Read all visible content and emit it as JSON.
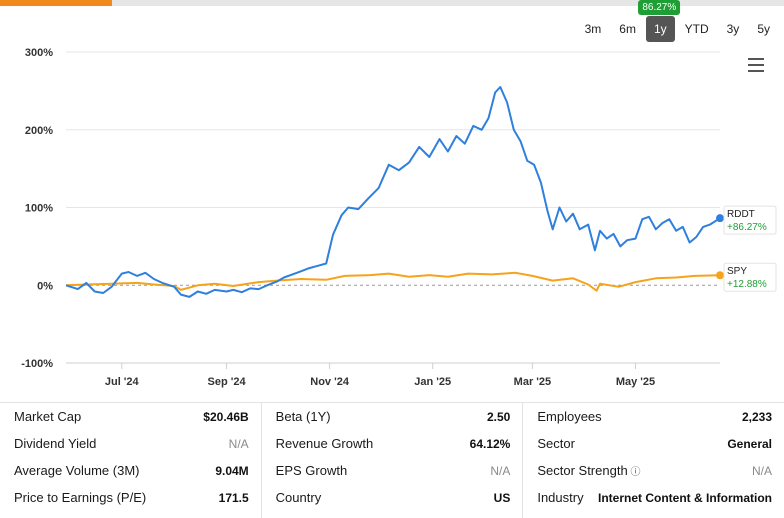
{
  "progress": {
    "fraction": 0.143,
    "color": "#f08a1c"
  },
  "range_tabs": [
    {
      "label": "3m",
      "active": false
    },
    {
      "label": "6m",
      "active": false
    },
    {
      "label": "1y",
      "active": true
    },
    {
      "label": "YTD",
      "active": false
    },
    {
      "label": "3y",
      "active": false
    },
    {
      "label": "5y",
      "active": false
    }
  ],
  "perf_badge": "86.27%",
  "menu": {
    "icon": "hamburger-menu-icon"
  },
  "chart_data": {
    "type": "line",
    "title": "",
    "xlabel": "",
    "ylabel": "",
    "ylim": [
      -100,
      300
    ],
    "y_ticks": [
      "300%",
      "200%",
      "100%",
      "0%",
      "-100%"
    ],
    "y_tick_values": [
      300,
      200,
      100,
      0,
      -100
    ],
    "x_range": [
      "2024-05-29",
      "2025-06-20"
    ],
    "x_ticks": [
      {
        "date": "2024-07-01",
        "label": "Jul '24"
      },
      {
        "date": "2024-09-01",
        "label": "Sep '24"
      },
      {
        "date": "2024-11-01",
        "label": "Nov '24"
      },
      {
        "date": "2025-01-01",
        "label": "Jan '25"
      },
      {
        "date": "2025-03-01",
        "label": "Mar '25"
      },
      {
        "date": "2025-05-01",
        "label": "May '25"
      }
    ],
    "grid": "horizontal",
    "legend": "right-end labels",
    "series": [
      {
        "name": "RDDT",
        "change": "+86.27%",
        "color": "#2f7fde",
        "change_color": "#1e9e34",
        "points": [
          [
            "2024-05-29",
            0
          ],
          [
            "2024-06-05",
            -5
          ],
          [
            "2024-06-10",
            3
          ],
          [
            "2024-06-15",
            -8
          ],
          [
            "2024-06-20",
            -10
          ],
          [
            "2024-06-25",
            -2
          ],
          [
            "2024-07-01",
            15
          ],
          [
            "2024-07-05",
            17
          ],
          [
            "2024-07-10",
            12
          ],
          [
            "2024-07-15",
            16
          ],
          [
            "2024-07-20",
            8
          ],
          [
            "2024-07-25",
            3
          ],
          [
            "2024-08-01",
            -2
          ],
          [
            "2024-08-05",
            -12
          ],
          [
            "2024-08-10",
            -15
          ],
          [
            "2024-08-15",
            -8
          ],
          [
            "2024-08-20",
            -11
          ],
          [
            "2024-08-25",
            -6
          ],
          [
            "2024-09-01",
            -8
          ],
          [
            "2024-09-05",
            -6
          ],
          [
            "2024-09-10",
            -9
          ],
          [
            "2024-09-15",
            -4
          ],
          [
            "2024-09-20",
            -5
          ],
          [
            "2024-09-25",
            0
          ],
          [
            "2024-10-01",
            5
          ],
          [
            "2024-10-05",
            10
          ],
          [
            "2024-10-10",
            14
          ],
          [
            "2024-10-15",
            18
          ],
          [
            "2024-10-20",
            22
          ],
          [
            "2024-10-25",
            25
          ],
          [
            "2024-10-30",
            28
          ],
          [
            "2024-11-03",
            65
          ],
          [
            "2024-11-08",
            90
          ],
          [
            "2024-11-12",
            100
          ],
          [
            "2024-11-18",
            98
          ],
          [
            "2024-11-24",
            112
          ],
          [
            "2024-11-30",
            125
          ],
          [
            "2024-12-06",
            155
          ],
          [
            "2024-12-12",
            148
          ],
          [
            "2024-12-18",
            158
          ],
          [
            "2024-12-24",
            178
          ],
          [
            "2024-12-30",
            165
          ],
          [
            "2025-01-05",
            188
          ],
          [
            "2025-01-10",
            172
          ],
          [
            "2025-01-15",
            192
          ],
          [
            "2025-01-20",
            182
          ],
          [
            "2025-01-25",
            205
          ],
          [
            "2025-01-30",
            200
          ],
          [
            "2025-02-03",
            215
          ],
          [
            "2025-02-07",
            248
          ],
          [
            "2025-02-10",
            255
          ],
          [
            "2025-02-14",
            235
          ],
          [
            "2025-02-18",
            200
          ],
          [
            "2025-02-22",
            185
          ],
          [
            "2025-02-26",
            160
          ],
          [
            "2025-03-02",
            155
          ],
          [
            "2025-03-06",
            132
          ],
          [
            "2025-03-10",
            95
          ],
          [
            "2025-03-13",
            72
          ],
          [
            "2025-03-17",
            100
          ],
          [
            "2025-03-21",
            82
          ],
          [
            "2025-03-25",
            92
          ],
          [
            "2025-03-29",
            72
          ],
          [
            "2025-04-03",
            78
          ],
          [
            "2025-04-07",
            45
          ],
          [
            "2025-04-10",
            70
          ],
          [
            "2025-04-14",
            60
          ],
          [
            "2025-04-18",
            66
          ],
          [
            "2025-04-22",
            50
          ],
          [
            "2025-04-26",
            58
          ],
          [
            "2025-05-01",
            60
          ],
          [
            "2025-05-05",
            85
          ],
          [
            "2025-05-09",
            88
          ],
          [
            "2025-05-13",
            72
          ],
          [
            "2025-05-17",
            80
          ],
          [
            "2025-05-21",
            85
          ],
          [
            "2025-05-25",
            70
          ],
          [
            "2025-05-29",
            75
          ],
          [
            "2025-06-02",
            55
          ],
          [
            "2025-06-06",
            62
          ],
          [
            "2025-06-10",
            75
          ],
          [
            "2025-06-14",
            78
          ],
          [
            "2025-06-20",
            86.27
          ]
        ]
      },
      {
        "name": "SPY",
        "change": "+12.88%",
        "color": "#f5a31a",
        "change_color": "#1e9e34",
        "points": [
          [
            "2024-05-29",
            0
          ],
          [
            "2024-06-10",
            1
          ],
          [
            "2024-06-25",
            2
          ],
          [
            "2024-07-10",
            3
          ],
          [
            "2024-07-20",
            1
          ],
          [
            "2024-08-01",
            -1
          ],
          [
            "2024-08-05",
            -6
          ],
          [
            "2024-08-15",
            0
          ],
          [
            "2024-08-25",
            2
          ],
          [
            "2024-09-05",
            -1
          ],
          [
            "2024-09-20",
            4
          ],
          [
            "2024-10-01",
            6
          ],
          [
            "2024-10-15",
            8
          ],
          [
            "2024-10-30",
            7
          ],
          [
            "2024-11-10",
            12
          ],
          [
            "2024-11-25",
            13
          ],
          [
            "2024-12-06",
            15
          ],
          [
            "2024-12-18",
            11
          ],
          [
            "2024-12-30",
            13
          ],
          [
            "2025-01-10",
            11
          ],
          [
            "2025-01-22",
            15
          ],
          [
            "2025-02-05",
            14
          ],
          [
            "2025-02-19",
            16
          ],
          [
            "2025-03-01",
            12
          ],
          [
            "2025-03-13",
            6
          ],
          [
            "2025-03-25",
            9
          ],
          [
            "2025-04-03",
            1
          ],
          [
            "2025-04-08",
            -7
          ],
          [
            "2025-04-10",
            2
          ],
          [
            "2025-04-21",
            -2
          ],
          [
            "2025-05-01",
            4
          ],
          [
            "2025-05-13",
            9
          ],
          [
            "2025-05-25",
            10
          ],
          [
            "2025-06-05",
            12
          ],
          [
            "2025-06-20",
            12.88
          ]
        ]
      }
    ]
  },
  "stats": {
    "col1": [
      {
        "label": "Market Cap",
        "value": "$20.46B",
        "na": false
      },
      {
        "label": "Dividend Yield",
        "value": "N/A",
        "na": true
      },
      {
        "label": "Average Volume (3M)",
        "value": "9.04M",
        "na": false
      },
      {
        "label": "Price to Earnings (P/E)",
        "value": "171.5",
        "na": false
      }
    ],
    "col2": [
      {
        "label": "Beta (1Y)",
        "value": "2.50",
        "na": false
      },
      {
        "label": "Revenue Growth",
        "value": "64.12%",
        "na": false
      },
      {
        "label": "EPS Growth",
        "value": "N/A",
        "na": true
      },
      {
        "label": "Country",
        "value": "US",
        "na": false
      }
    ],
    "col3": [
      {
        "label": "Employees",
        "value": "2,233",
        "na": false
      },
      {
        "label": "Sector",
        "value": "General",
        "na": false
      },
      {
        "label": "Sector Strength",
        "value": "N/A",
        "na": true,
        "icon": "info-icon"
      },
      {
        "label": "Industry",
        "value": "Internet Content & Information",
        "na": false
      }
    ]
  }
}
